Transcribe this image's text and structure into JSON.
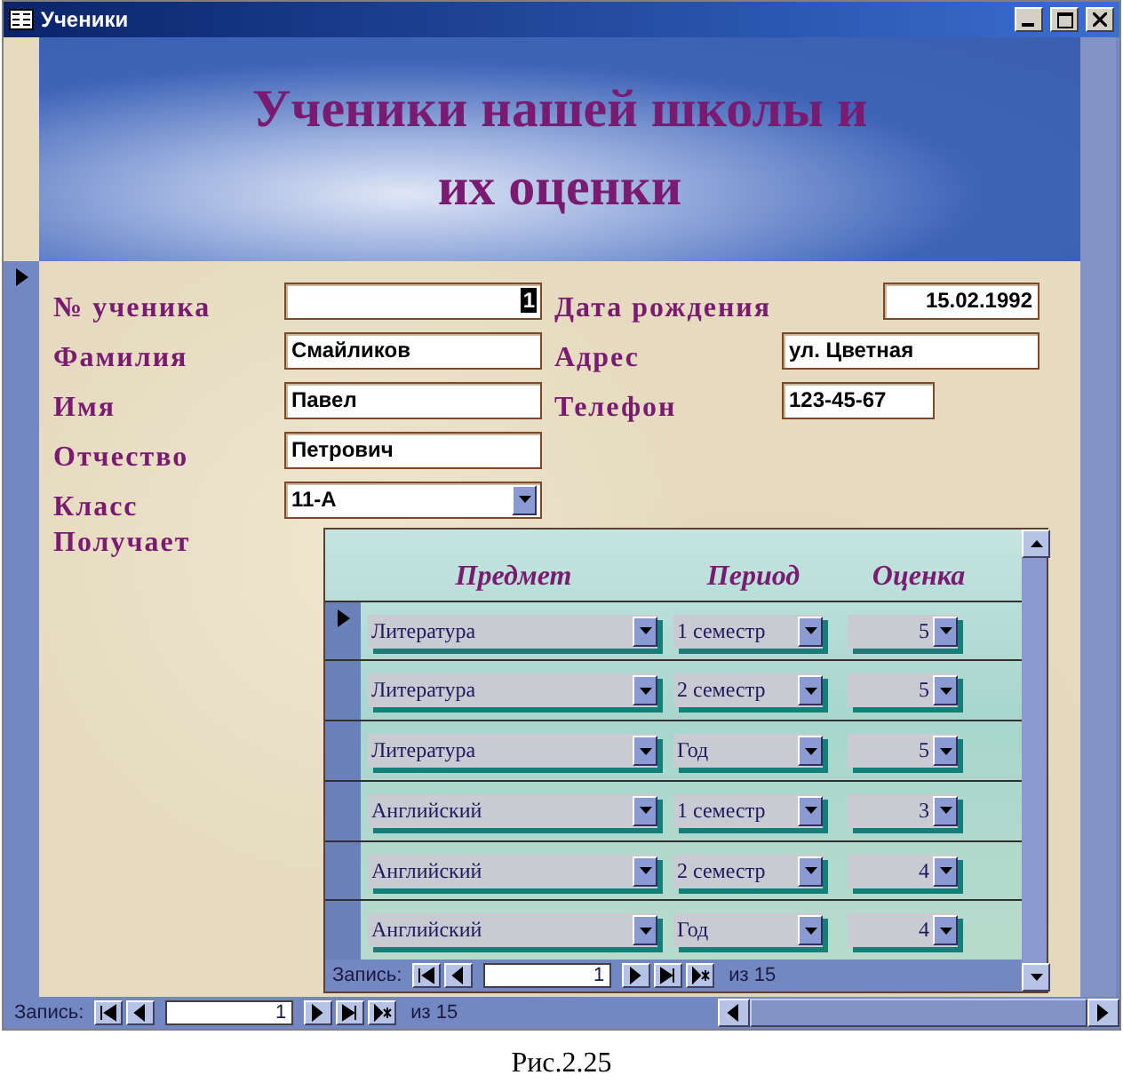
{
  "window": {
    "title": "Ученики"
  },
  "header": {
    "title": "Ученики нашей школы и\nих оценки"
  },
  "record": {
    "selected": true
  },
  "rows": [
    {
      "left": {
        "label": "№ ученика",
        "value": "1",
        "kind": "counter",
        "selected": true
      },
      "right": {
        "label": "Дата рождения",
        "value": "15.02.1992",
        "kind": "date",
        "selected": false
      }
    },
    {
      "left": {
        "label": "Фамилия",
        "value": "Смайликов",
        "kind": "text",
        "selected": false
      },
      "right": {
        "label": "Адрес",
        "value": "ул. Цветная",
        "kind": "text",
        "selected": false
      }
    },
    {
      "left": {
        "label": "Имя",
        "value": "Павел",
        "kind": "text",
        "selected": false
      },
      "right": {
        "label": "Телефон",
        "value": "123-45-67",
        "kind": "short",
        "selected": false
      }
    },
    {
      "left": {
        "label": "Отчество",
        "value": "Петрович",
        "kind": "text",
        "selected": false
      }
    },
    {
      "left": {
        "label": "Класс",
        "value": "11-А",
        "kind": "combo",
        "selected": false
      }
    }
  ],
  "subform": {
    "label": "Получает",
    "columns": [
      "Предмет",
      "Период",
      "Оценка"
    ],
    "rows": [
      {
        "subject": "Литература",
        "period": "1 семестр",
        "grade": "5",
        "selected": true
      },
      {
        "subject": "Литература",
        "period": "2 семестр",
        "grade": "5",
        "selected": false
      },
      {
        "subject": "Литература",
        "period": "Год",
        "grade": "5",
        "selected": false
      },
      {
        "subject": "Английский",
        "period": "1 семестр",
        "grade": "3",
        "selected": false
      },
      {
        "subject": "Английский",
        "period": "2 семестр",
        "grade": "4",
        "selected": false
      },
      {
        "subject": "Английский",
        "period": "Год",
        "grade": "4",
        "selected": false
      }
    ],
    "navigation": {
      "label": "Запись:",
      "current": "1",
      "total": "из 15"
    }
  },
  "navigation": {
    "label": "Запись:",
    "current": "1",
    "total": "из 15"
  },
  "caption": "Рис.2.25"
}
